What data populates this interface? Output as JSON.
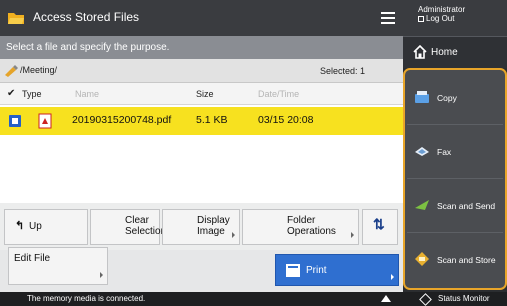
{
  "titlebar": {
    "title": "Access Stored Files"
  },
  "admin": {
    "line1": "Administrator",
    "line2": "Log Out"
  },
  "home": {
    "label": "Home"
  },
  "instruction": "Select a file and specify the purpose.",
  "path": {
    "text": "/Meeting/",
    "selected": "Selected: 1"
  },
  "headers": {
    "type": "Type",
    "name": "Name",
    "size": "Size",
    "datetime": "Date/Time"
  },
  "files": [
    {
      "name": "20190315200748.pdf",
      "size": "5.1 KB",
      "datetime": "03/15  20:08"
    }
  ],
  "buttons": {
    "up": "Up",
    "clear_l1": "Clear",
    "clear_l2": "Selection",
    "display_l1": "Display",
    "display_l2": "Image",
    "folder_l1": "Folder",
    "folder_l2": "Operations",
    "edit": "Edit File",
    "print": "Print"
  },
  "functions": {
    "copy": "Copy",
    "fax": "Fax",
    "scan_send": "Scan and Send",
    "scan_store": "Scan and Store"
  },
  "status": {
    "message": "The memory media is connected.",
    "monitor": "Status Monitor"
  },
  "colors": {
    "selection": "#f7e11f",
    "accent": "#e8a52a",
    "print_button": "#2f6fd0"
  }
}
